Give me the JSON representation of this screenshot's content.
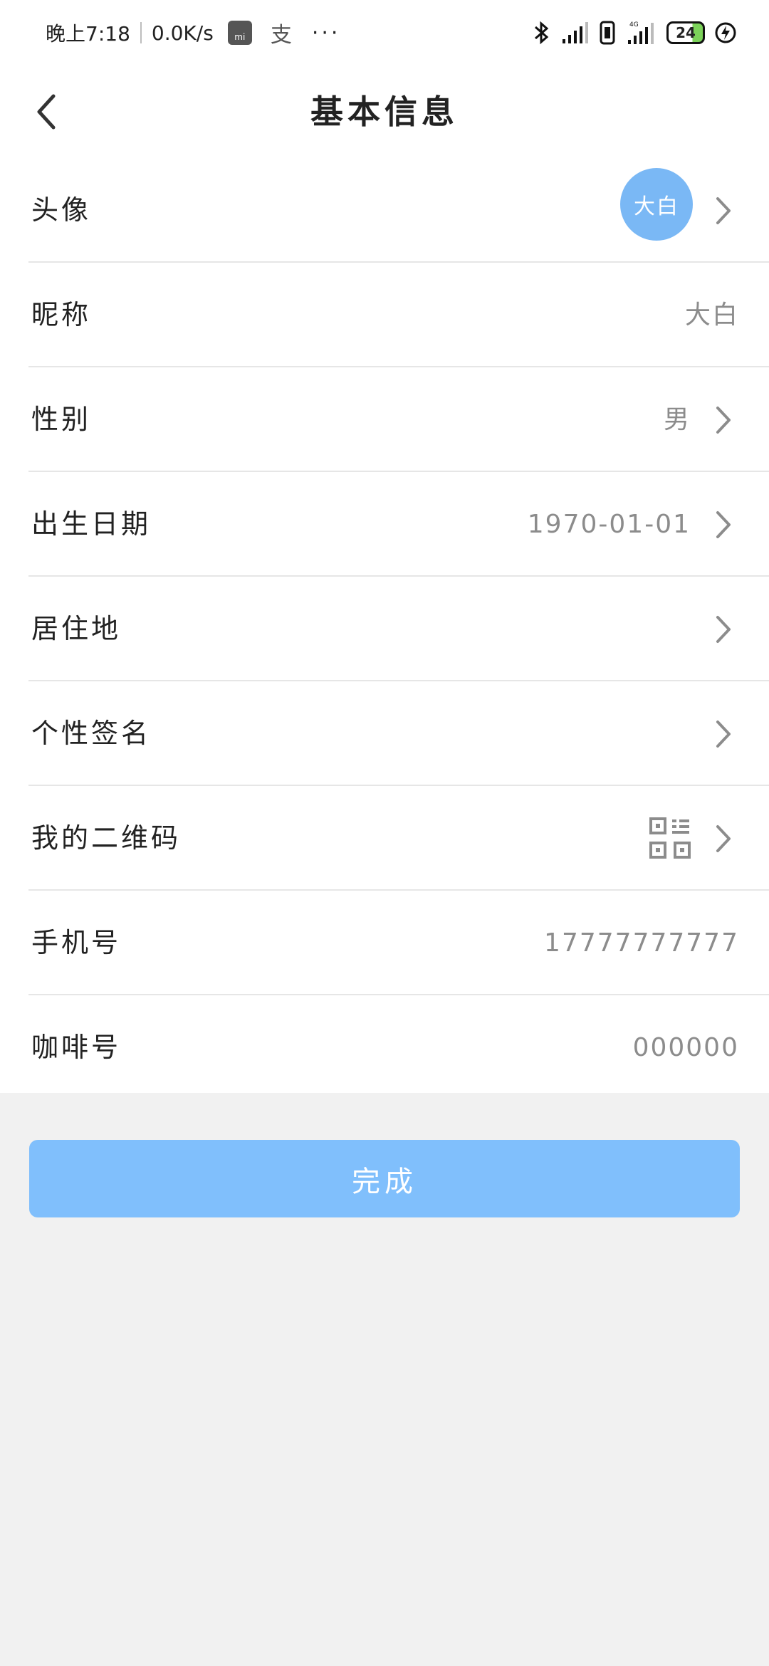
{
  "status_bar": {
    "time": "晚上7:18",
    "speed": "0.0K/s",
    "mi_badge": "mi",
    "pay_glyph": "支",
    "more_dots": "···",
    "network_label": "4G",
    "battery": "24"
  },
  "nav": {
    "title": "基本信息"
  },
  "rows": [
    {
      "label": "头像",
      "avatar_text": "大白"
    },
    {
      "label": "昵称",
      "value": "大白"
    },
    {
      "label": "性别",
      "value": "男"
    },
    {
      "label": "出生日期",
      "value": "1970-01-01"
    },
    {
      "label": "居住地",
      "value": ""
    },
    {
      "label": "个性签名",
      "value": ""
    },
    {
      "label": "我的二维码"
    },
    {
      "label": "手机号",
      "value": "17777777777"
    },
    {
      "label": "咖啡号",
      "value": "000000"
    }
  ],
  "colors": {
    "accent_button": "#80bffc",
    "avatar_bg": "#7ab8f5",
    "value_text": "#8c8c8c"
  },
  "done_button": {
    "label": "完成"
  }
}
